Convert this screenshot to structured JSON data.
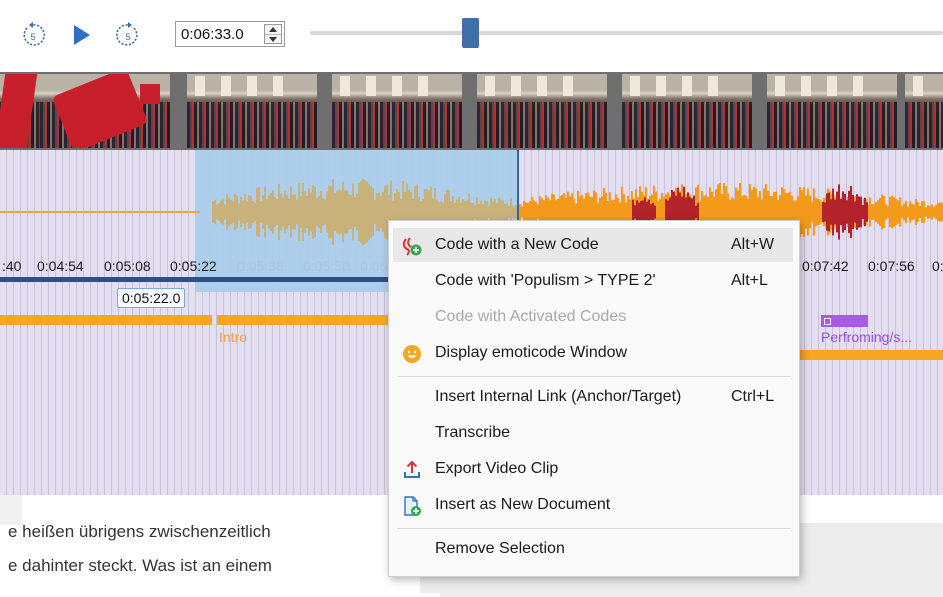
{
  "toolbar": {
    "time_value": "0:06:33.0",
    "icons": {
      "rewind": "rewind-5-icon",
      "play": "play-icon",
      "forward": "forward-5-icon"
    },
    "rewind_label": "5",
    "forward_label": "5",
    "accent_color": "#3e6fa8"
  },
  "timeline": {
    "ruler_labels": [
      ":40",
      "0:04:54",
      "0:05:08",
      "0:05:22",
      "0:05:36",
      "0:05:50",
      "0:06",
      "0:07:42",
      "0:07:56",
      "0:"
    ],
    "hover_time": "0:05:22.0",
    "code_labels": [
      "Intro",
      "Perfroming/s..."
    ],
    "selection_color": "#a9cdec",
    "waveform_colors": [
      "#c9b27a",
      "#f39a1a",
      "#b3232a"
    ]
  },
  "document": {
    "lines": [
      "e heißen übrigens zwischenzeitlich",
      "e dahinter steckt. Was ist an einem"
    ]
  },
  "context_menu": {
    "items": [
      {
        "label": "Code with a New Code",
        "shortcut": "Alt+W",
        "icon": "new-code-icon"
      },
      {
        "label": "Code with 'Populism > TYPE 2'",
        "shortcut": "Alt+L"
      },
      {
        "label": "Code with Activated Codes",
        "shortcut": ""
      },
      {
        "label": "Display emoticode Window",
        "shortcut": "",
        "icon": "emoticon-icon"
      },
      {
        "label": "Insert Internal Link (Anchor/Target)",
        "shortcut": "Ctrl+L"
      },
      {
        "label": "Transcribe",
        "shortcut": ""
      },
      {
        "label": "Export Video Clip",
        "shortcut": "",
        "icon": "export-icon"
      },
      {
        "label": "Insert as New Document",
        "shortcut": "",
        "icon": "new-document-icon"
      },
      {
        "label": "Remove Selection",
        "shortcut": ""
      }
    ]
  }
}
